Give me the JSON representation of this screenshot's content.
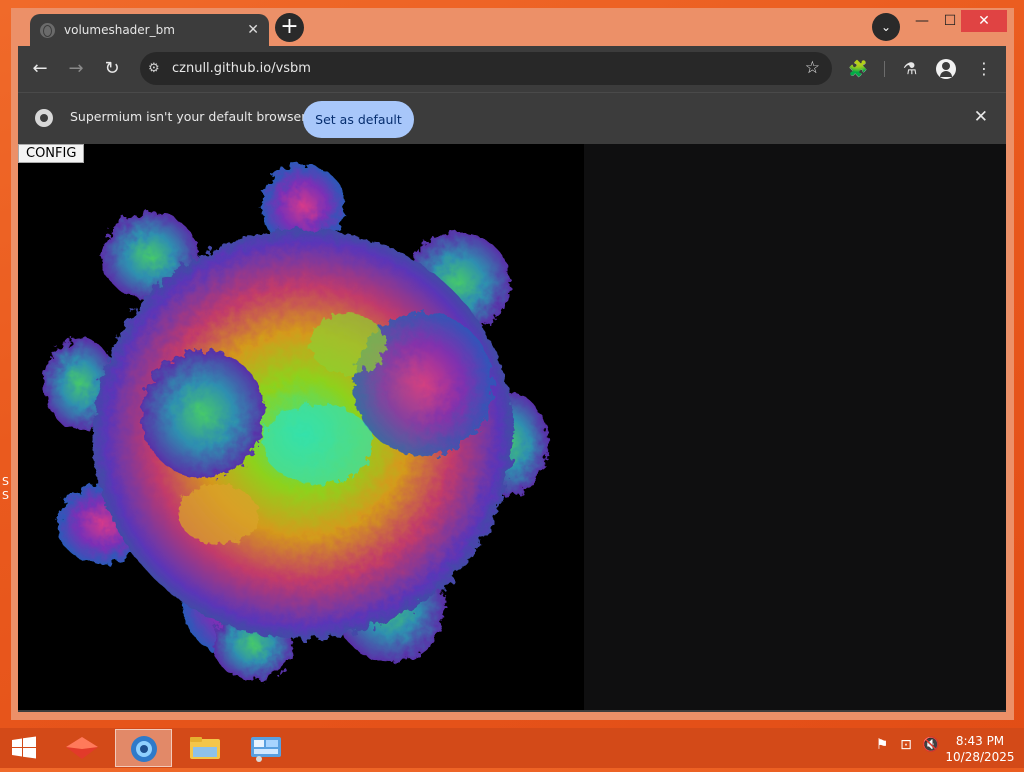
{
  "tab": {
    "title": "volumeshader_bm",
    "close": "✕"
  },
  "toolbar": {
    "back": "←",
    "forward": "→",
    "reload": "↻",
    "url": "cznull.github.io/vsbm",
    "site_info": "⚙",
    "star": "☆",
    "extensions": "🧩",
    "labs": "⚗",
    "menu": "⋮"
  },
  "tabbar": {
    "new_tab": "+",
    "tab_search": "⌄",
    "minimize": "—",
    "maximize": "☐",
    "close": "✕"
  },
  "infobar": {
    "message": "Supermium isn't your default browser",
    "set_default_label": "Set as default",
    "close": "✕"
  },
  "page": {
    "config_label": "CONFIG"
  },
  "taskbar": {
    "clock_time": "8:43 PM",
    "clock_date": "10/28/2025"
  },
  "desktop_fragments": [
    "S",
    "S"
  ],
  "colors": {
    "desktop": "#ea5a1e",
    "browser_frame": "#ec9068",
    "chrome_dark": "#3c3c3c",
    "accent": "#a8c7fa",
    "taskbar": "#d34a18"
  }
}
